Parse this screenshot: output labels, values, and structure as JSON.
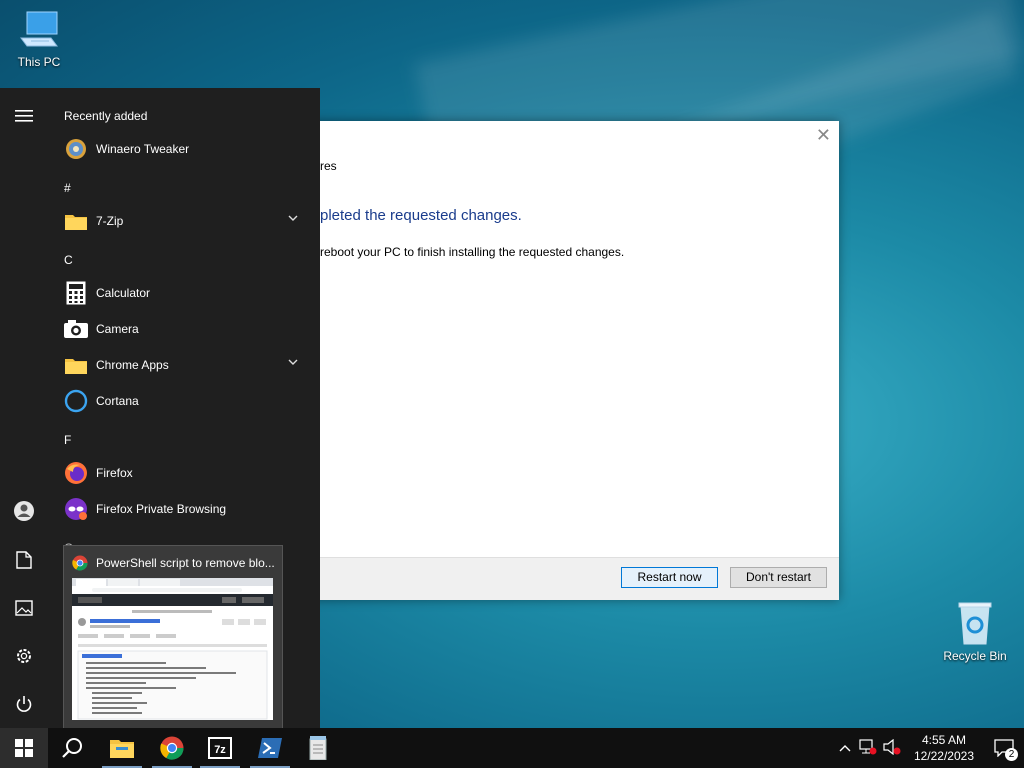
{
  "desktop": {
    "this_pc_label": "This PC",
    "recycle_bin_label": "Recycle Bin"
  },
  "dialog": {
    "title_fragment": "res",
    "heading": "pleted the requested changes.",
    "body": "reboot your PC to finish installing the requested changes.",
    "restart_now": "Restart now",
    "dont_restart": "Don't restart",
    "close_glyph": "✕"
  },
  "start_menu": {
    "header": "Recently added",
    "sections": [
      "#",
      "C",
      "F",
      "G"
    ],
    "apps": [
      {
        "label": "Winaero Tweaker",
        "icon": "winaero-tweaker-icon"
      },
      {
        "label": "7-Zip",
        "icon": "folder-icon",
        "expandable": true
      },
      {
        "label": "Calculator",
        "icon": "calculator-icon"
      },
      {
        "label": "Camera",
        "icon": "camera-icon"
      },
      {
        "label": "Chrome Apps",
        "icon": "folder-icon",
        "expandable": true
      },
      {
        "label": "Cortana",
        "icon": "cortana-icon"
      },
      {
        "label": "Firefox",
        "icon": "firefox-icon"
      },
      {
        "label": "Firefox Private Browsing",
        "icon": "firefox-private-icon"
      }
    ],
    "rail": [
      "hamburger-icon",
      "user-icon",
      "documents-icon",
      "pictures-icon",
      "settings-icon",
      "power-icon"
    ]
  },
  "preview": {
    "title": "PowerShell script to remove blo..."
  },
  "taskbar": {
    "pinned": [
      "start-icon",
      "search-icon",
      "file-explorer-icon",
      "chrome-icon",
      "7zip-icon",
      "powershell-icon",
      "notepad-icon"
    ],
    "time": "4:55 AM",
    "date": "12/22/2023",
    "notifications": "2"
  },
  "colors": {
    "accent": "#0078d7",
    "start_bg": "#1f1f1f",
    "heading_blue": "#1a3c8c",
    "taskbar_bg": "#101010"
  }
}
